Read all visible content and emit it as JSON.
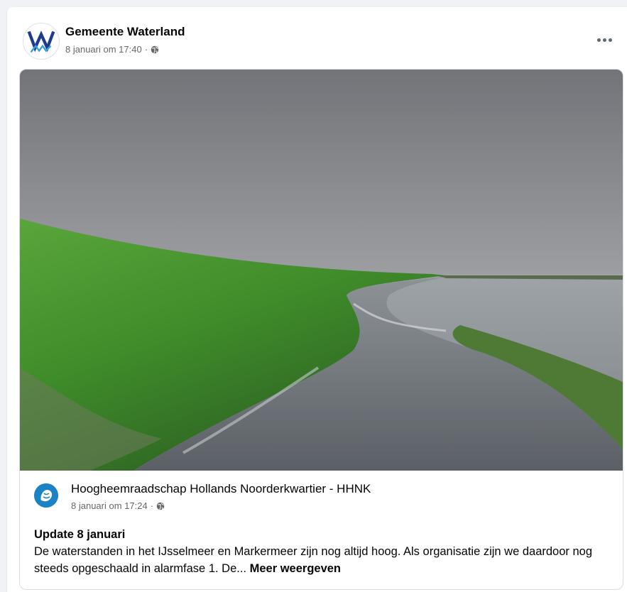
{
  "post": {
    "author": "Gemeente Waterland",
    "timestamp": "8 januari om 17:40",
    "separator": "·",
    "privacy_icon": "globe-icon",
    "more_icon": "more-horizontal-icon"
  },
  "shared_post": {
    "author": "Hoogheemraadschap Hollands Noorderkwartier - HHNK",
    "timestamp": "8 januari om 17:24",
    "separator": "·",
    "privacy_icon": "globe-icon",
    "title": "Update 8 januari",
    "body": "De waterstanden in het IJsselmeer en Markermeer zijn nog altijd hoog. Als organisatie zijn we daardoor nog steeds opgeschaald in alarmfase 1. De...",
    "see_more": "Meer weergeven"
  },
  "colors": {
    "brand_blue": "#1b82c5",
    "waterland_blue": "#1f3b8c",
    "grass_green": "#4d9a32"
  }
}
